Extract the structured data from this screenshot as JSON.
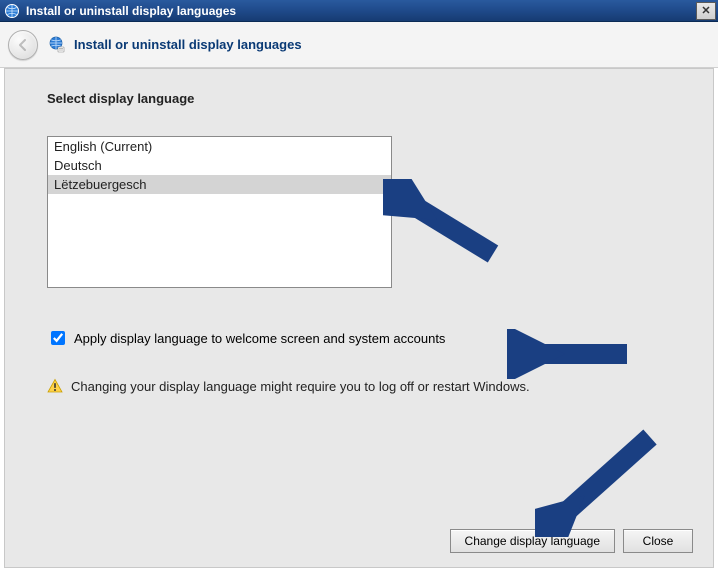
{
  "window": {
    "title": "Install or uninstall display languages"
  },
  "header": {
    "title": "Install or uninstall display languages"
  },
  "content": {
    "section_heading": "Select display language",
    "languages": [
      {
        "label": "English (Current)",
        "selected": false
      },
      {
        "label": "Deutsch",
        "selected": false
      },
      {
        "label": "Lëtzebuergesch",
        "selected": true
      }
    ],
    "apply_checkbox": {
      "checked": true,
      "label": "Apply display language to welcome screen and system accounts"
    },
    "warning": "Changing your display language might require you to log off or restart Windows."
  },
  "buttons": {
    "primary": "Change display language",
    "close": "Close"
  }
}
